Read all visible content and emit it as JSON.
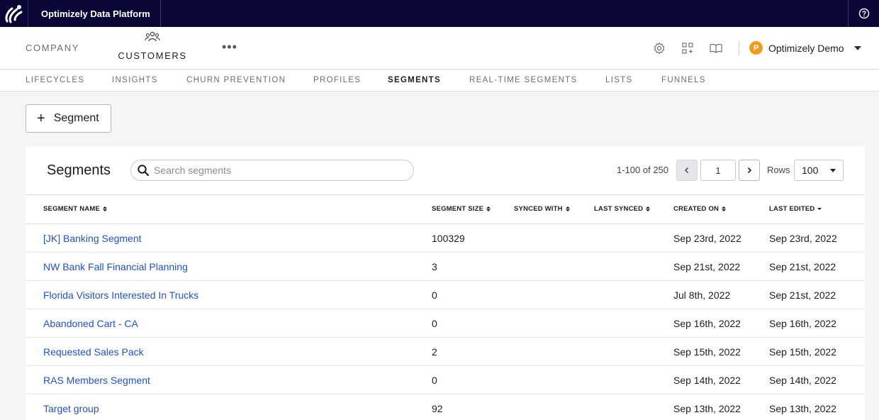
{
  "app": {
    "name": "Optimizely Data Platform"
  },
  "main_nav": {
    "company": "COMPANY",
    "customers": "CUSTOMERS",
    "more": "•••"
  },
  "org": {
    "avatar_letter": "P",
    "name": "Optimizely Demo"
  },
  "sub_nav": {
    "tabs": [
      "LIFECYCLES",
      "INSIGHTS",
      "CHURN PREVENTION",
      "PROFILES",
      "SEGMENTS",
      "REAL-TIME SEGMENTS",
      "LISTS",
      "FUNNELS"
    ],
    "active": "SEGMENTS"
  },
  "add_button": {
    "plus": "+",
    "label": "Segment"
  },
  "card": {
    "title": "Segments",
    "search_placeholder": "Search segments",
    "range_text": "1-100 of 250",
    "page": "1",
    "rows_label": "Rows",
    "rows_value": "100"
  },
  "table": {
    "headers": [
      "SEGMENT NAME",
      "SEGMENT SIZE",
      "SYNCED WITH",
      "LAST SYNCED",
      "CREATED ON",
      "LAST EDITED"
    ],
    "rows": [
      {
        "name": "[JK] Banking Segment",
        "size": "100329",
        "synced_with": "",
        "last_synced": "",
        "created": "Sep 23rd, 2022",
        "edited": "Sep 23rd, 2022"
      },
      {
        "name": "NW Bank Fall Financial Planning",
        "size": "3",
        "synced_with": "",
        "last_synced": "",
        "created": "Sep 21st, 2022",
        "edited": "Sep 21st, 2022"
      },
      {
        "name": "Florida Visitors Interested In Trucks",
        "size": "0",
        "synced_with": "",
        "last_synced": "",
        "created": "Jul 8th, 2022",
        "edited": "Sep 21st, 2022"
      },
      {
        "name": "Abandoned Cart - CA",
        "size": "0",
        "synced_with": "",
        "last_synced": "",
        "created": "Sep 16th, 2022",
        "edited": "Sep 16th, 2022"
      },
      {
        "name": "Requested Sales Pack",
        "size": "2",
        "synced_with": "",
        "last_synced": "",
        "created": "Sep 15th, 2022",
        "edited": "Sep 15th, 2022"
      },
      {
        "name": "RAS Members Segment",
        "size": "0",
        "synced_with": "",
        "last_synced": "",
        "created": "Sep 14th, 2022",
        "edited": "Sep 14th, 2022"
      },
      {
        "name": "Target group",
        "size": "92",
        "synced_with": "",
        "last_synced": "",
        "created": "Sep 13th, 2022",
        "edited": "Sep 13th, 2022"
      }
    ]
  }
}
